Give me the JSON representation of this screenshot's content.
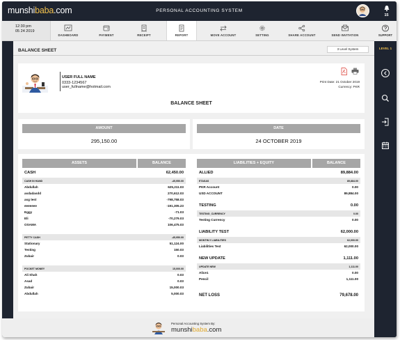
{
  "app": {
    "logo_main": "munshi",
    "logo_accent": "baba",
    "logo_suffix": ".com",
    "system_title": "PERSONAL ACCOUNTING SYSTEM",
    "notification_count": "15"
  },
  "nav": {
    "time": "12:30 pm",
    "date": "05 24 2019",
    "items": [
      {
        "label": "DASHBOARD",
        "icon": "dashboard-icon"
      },
      {
        "label": "PAYMENT",
        "icon": "wallet-icon"
      },
      {
        "label": "RECEIPT",
        "icon": "receipt-icon"
      },
      {
        "label": "REPORT",
        "icon": "report-icon"
      },
      {
        "label": "MOVE ACCOUNT",
        "icon": "transfer-icon"
      },
      {
        "label": "SETTING",
        "icon": "gear-icon"
      },
      {
        "label": "SHARE ACCOUNT",
        "icon": "share-icon"
      },
      {
        "label": "SEND INVITATION",
        "icon": "mail-icon"
      }
    ],
    "support_label": "SUPPORT",
    "active": "REPORT"
  },
  "sidebar": {
    "level": "LEVEL 1",
    "icons": [
      "arrow-left-circle-icon",
      "search-icon",
      "login-icon",
      "calendar-icon"
    ]
  },
  "page": {
    "title": "BALANCE SHEET",
    "level_system": "3 Level System"
  },
  "profile": {
    "name": "USER FULL NAME",
    "phone": "0333-1234567",
    "email": "user_fullname@hotmail.com",
    "print_date": "Print Date: 21 October 2019",
    "currency": "Currency: PKR",
    "report_title": "BALANCE SHEET"
  },
  "summary": {
    "amount_label": "AMOUNT",
    "amount_value": "295,150.00",
    "date_label": "DATE",
    "date_value": "24 OCTOBER 2019"
  },
  "assets": {
    "header_name": "ASSETS",
    "header_balance": "BALANCE",
    "rows": [
      {
        "type": "cat",
        "name": "CASH",
        "value": "62,450.00"
      },
      {
        "type": "sub",
        "name": "CASH IN HAND",
        "value": "-45,950.00"
      },
      {
        "type": "item",
        "name": "Abdullah",
        "value": "625,211.03"
      },
      {
        "type": "item",
        "name": "asdadasdd",
        "value": "270,612.03"
      },
      {
        "type": "item",
        "name": "asg test",
        "value": "-798,758.03"
      },
      {
        "type": "item",
        "name": "eeeeeee",
        "value": "-191,305.23"
      },
      {
        "type": "item",
        "name": "Eggy",
        "value": "-71.03"
      },
      {
        "type": "item",
        "name": "Eli",
        "value": "-70,279.03"
      },
      {
        "type": "item",
        "name": "OSAMA",
        "value": "106,475.03"
      },
      {
        "type": "gap"
      },
      {
        "type": "sub",
        "name": "PETTY CASH",
        "value": "-45,950.00"
      },
      {
        "type": "item",
        "name": "Stationary",
        "value": "51,124.00"
      },
      {
        "type": "item",
        "name": "Testing",
        "value": "150.03"
      },
      {
        "type": "item",
        "name": "Zubair",
        "value": "0.03"
      },
      {
        "type": "gap"
      },
      {
        "type": "sub",
        "name": "POCKET MONEY",
        "value": "15,000.00"
      },
      {
        "type": "item",
        "name": "Ali Shah",
        "value": "0.03"
      },
      {
        "type": "item",
        "name": "Asad",
        "value": "0.03"
      },
      {
        "type": "item",
        "name": "Zubair",
        "value": "15,000.03"
      },
      {
        "type": "item",
        "name": "Abdullah",
        "value": "5,000.03"
      }
    ]
  },
  "liabilities": {
    "header_name": "LIABILITIES + EQUITY",
    "header_balance": "BALANCE",
    "rows": [
      {
        "type": "cat",
        "name": "ALLIED",
        "value": "89,884.00"
      },
      {
        "type": "sub",
        "name": "ETASAS",
        "value": "89,884.00"
      },
      {
        "type": "item",
        "name": "PKR Account",
        "value": "0.00"
      },
      {
        "type": "item",
        "name": "USD ACCOUNT",
        "value": "89,884.00"
      },
      {
        "type": "gap"
      },
      {
        "type": "cat",
        "name": "TESTING",
        "value": "0.00"
      },
      {
        "type": "sub",
        "name": "TESTING_CURRENCY",
        "value": "0.00"
      },
      {
        "type": "item",
        "name": "Testing Currency",
        "value": "0.00"
      },
      {
        "type": "gap"
      },
      {
        "type": "cat",
        "name": "LIABILITY TEST",
        "value": "62,000.00"
      },
      {
        "type": "sub",
        "name": "MONTHLY LIABILITIES",
        "value": "62,000.00"
      },
      {
        "type": "item",
        "name": "Liabilities Test",
        "value": "62,000.00"
      },
      {
        "type": "gap"
      },
      {
        "type": "cat",
        "name": "NEW UPDATE",
        "value": "1,111.00"
      },
      {
        "type": "sub",
        "name": "UPDATE NEW",
        "value": "1,111.00"
      },
      {
        "type": "item",
        "name": "Alice1",
        "value": "0.00"
      },
      {
        "type": "item",
        "name": "Pencil",
        "value": "1,111.00"
      }
    ],
    "net_loss_label": "NET LOSS",
    "net_loss_value": "79,678.00"
  },
  "footer": {
    "by_text": "Personal Accounting System By:",
    "logo_main": "munshi",
    "logo_accent": "baba",
    "logo_suffix": ".com"
  }
}
